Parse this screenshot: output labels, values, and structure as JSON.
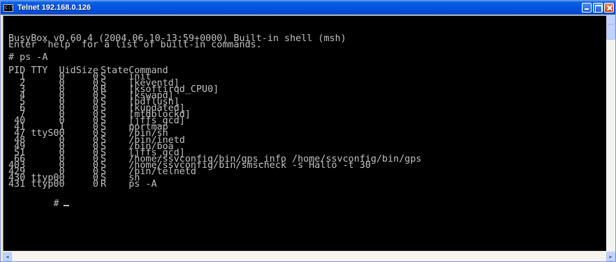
{
  "window": {
    "title": "Telnet 192.168.0.126",
    "icon": "console-icon",
    "icon_label": "C:\\"
  },
  "terminal": {
    "banner": [
      "BusyBox v0.60.4 (2004.06.10-13:59+0000) Built-in shell (msh)",
      "Enter 'help' for a list of built-in commands."
    ],
    "command_line": "# ps -A",
    "headers": {
      "pid": "PID",
      "tty": "TTY",
      "uid": "Uid",
      "size": "Size",
      "state": "State",
      "command": "Command"
    },
    "processes": [
      {
        "pid": "1",
        "tty": "",
        "uid": "0",
        "size": "0",
        "state": "S",
        "command": "init"
      },
      {
        "pid": "2",
        "tty": "",
        "uid": "0",
        "size": "0",
        "state": "S",
        "command": "[keventd]"
      },
      {
        "pid": "3",
        "tty": "",
        "uid": "0",
        "size": "0",
        "state": "R",
        "command": "[ksoftirqd_CPU0]"
      },
      {
        "pid": "4",
        "tty": "",
        "uid": "0",
        "size": "0",
        "state": "S",
        "command": "[kswapd]"
      },
      {
        "pid": "5",
        "tty": "",
        "uid": "0",
        "size": "0",
        "state": "S",
        "command": "[bdflush]"
      },
      {
        "pid": "6",
        "tty": "",
        "uid": "0",
        "size": "0",
        "state": "S",
        "command": "[kupdated]"
      },
      {
        "pid": "7",
        "tty": "",
        "uid": "0",
        "size": "0",
        "state": "S",
        "command": "[mtdblockd]"
      },
      {
        "pid": "40",
        "tty": "",
        "uid": "0",
        "size": "0",
        "state": "S",
        "command": "[jffs_gcd]"
      },
      {
        "pid": "41",
        "tty": "",
        "uid": "1",
        "size": "0",
        "state": "S",
        "command": "portmap"
      },
      {
        "pid": "47",
        "tty": "ttyS0",
        "uid": "0",
        "size": "0",
        "state": "S",
        "command": "/bin/sh"
      },
      {
        "pid": "48",
        "tty": "",
        "uid": "0",
        "size": "0",
        "state": "S",
        "command": "/bin/inetd"
      },
      {
        "pid": "49",
        "tty": "",
        "uid": "0",
        "size": "0",
        "state": "S",
        "command": "/bin/boa"
      },
      {
        "pid": "51",
        "tty": "",
        "uid": "0",
        "size": "0",
        "state": "S",
        "command": "[jffs_gcd]"
      },
      {
        "pid": "66",
        "tty": "",
        "uid": "0",
        "size": "0",
        "state": "S",
        "command": "/home/ssvconfig/bin/gps_info /home/ssvconfig/bin/gps"
      },
      {
        "pid": "403",
        "tty": "",
        "uid": "0",
        "size": "0",
        "state": "S",
        "command": "/home/ssvconfig/bin/smscheck -s Hallo -t 30"
      },
      {
        "pid": "429",
        "tty": "",
        "uid": "0",
        "size": "0",
        "state": "S",
        "command": "/bin/telnetd"
      },
      {
        "pid": "430",
        "tty": "ttyp0",
        "uid": "0",
        "size": "0",
        "state": "S",
        "command": "sh"
      },
      {
        "pid": "431",
        "tty": "ttyp0",
        "uid": "0",
        "size": "0",
        "state": "R",
        "command": "ps -A"
      }
    ],
    "prompt": "#",
    "colors": {
      "background": "#000000",
      "foreground": "#c0c0c0"
    }
  },
  "scrollbars": {
    "left_arrow": "◂",
    "right_arrow": "▸"
  }
}
